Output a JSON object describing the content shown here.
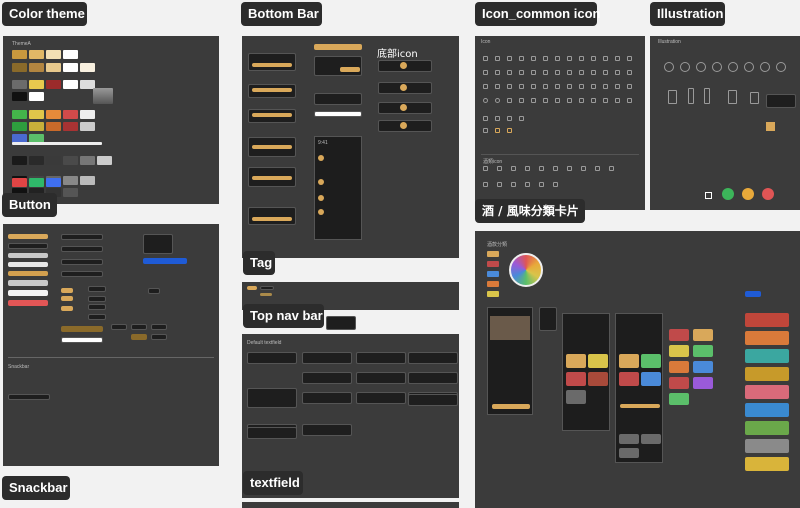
{
  "sections": {
    "color_theme": "Color theme",
    "button": "Button",
    "snackbar": "Snackbar",
    "bottom_bar": "Bottom Bar",
    "tag": "Tag",
    "top_nav_bar": "Top nav bar",
    "textfield": "textfield",
    "icon_common": "Icon_common icon",
    "illustration": "Illustration",
    "wine_card": "酒 / 風味分類卡片"
  },
  "annotations": {
    "bottom_icon": "底部icon"
  },
  "colors": {
    "canvas": "#f2f2f2",
    "frame": "#3b3b3b",
    "label_bg": "#2c2c2c",
    "gold": "#d9a85a",
    "blue": "#1f5bd6",
    "red": "#e05555",
    "green": "#3cb55a"
  },
  "icons": [
    "dropper-icon",
    "search-icon",
    "check-icon",
    "close-icon",
    "wine-glass-icon",
    "bottle-icon"
  ]
}
